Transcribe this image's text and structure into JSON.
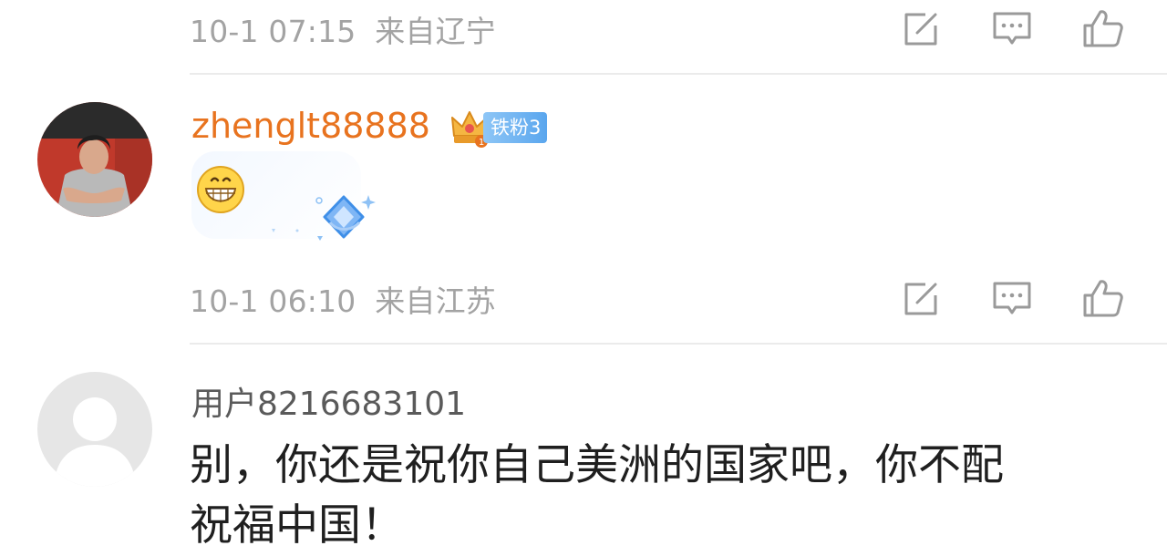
{
  "comments": [
    {
      "timestamp": "10-1 07:15",
      "location": "来自辽宁"
    },
    {
      "username": "zhenglt88888",
      "badge_level": "1",
      "fan_badge": "铁粉3",
      "avatar_icon": "user-photo-avatar",
      "sticker_icons": [
        "grinning-face-emoji",
        "diamond-sticker"
      ],
      "timestamp": "10-1 06:10",
      "location": "来自江苏",
      "username_color": "#e8731f"
    },
    {
      "username": "用户8216683101",
      "avatar_icon": "default-avatar",
      "text_line1": "别，你还是祝你自己美洲的国家吧，你不配",
      "text_line2": "祝福中国！"
    }
  ],
  "actions": {
    "share_icon": "edit-share-icon",
    "reply_icon": "comment-bubble-icon",
    "like_icon": "thumbs-up-icon"
  }
}
